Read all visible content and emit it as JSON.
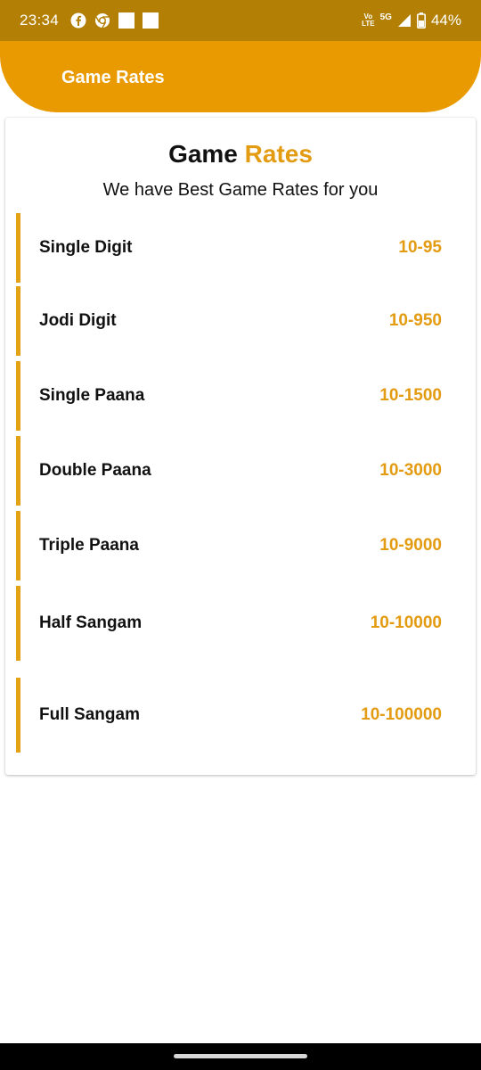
{
  "status_bar": {
    "time": "23:34",
    "left_icons": [
      "facebook-icon",
      "chrome-icon",
      "notification-square-icon",
      "notification-square-icon"
    ],
    "volte_line1": "Vo",
    "volte_line2": "LTE",
    "network": "5G",
    "battery": "44%"
  },
  "app_bar": {
    "title": "Game Rates"
  },
  "card": {
    "title_main": "Game ",
    "title_accent": "Rates",
    "subtitle": "We have Best Game Rates for you",
    "rates": [
      {
        "name": "Single Digit",
        "value": "10-95"
      },
      {
        "name": "Jodi Digit",
        "value": "10-950"
      },
      {
        "name": "Single Paana",
        "value": "10-1500"
      },
      {
        "name": "Double Paana",
        "value": "10-3000"
      },
      {
        "name": "Triple Paana",
        "value": "10-9000"
      },
      {
        "name": "Half Sangam",
        "value": "10-10000"
      },
      {
        "name": "Full Sangam",
        "value": "10-100000"
      }
    ]
  },
  "colors": {
    "status_bar": "#b37f04",
    "app_bar": "#e89a00",
    "accent_text": "#e39b12",
    "row_bar": "#e3a315"
  }
}
